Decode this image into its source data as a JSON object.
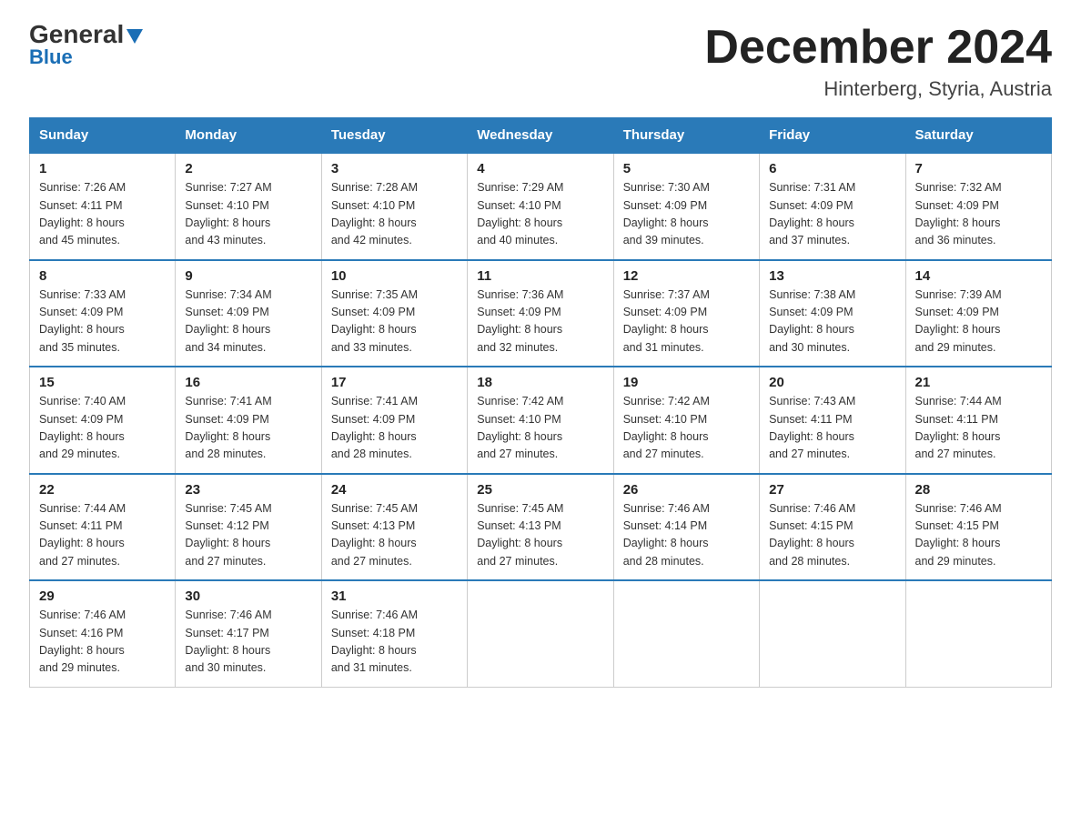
{
  "logo": {
    "part1": "General",
    "part2": "Blue"
  },
  "header": {
    "month": "December 2024",
    "location": "Hinterberg, Styria, Austria"
  },
  "days_of_week": [
    "Sunday",
    "Monday",
    "Tuesday",
    "Wednesday",
    "Thursday",
    "Friday",
    "Saturday"
  ],
  "weeks": [
    [
      {
        "num": "1",
        "sunrise": "7:26 AM",
        "sunset": "4:11 PM",
        "daylight": "8 hours and 45 minutes."
      },
      {
        "num": "2",
        "sunrise": "7:27 AM",
        "sunset": "4:10 PM",
        "daylight": "8 hours and 43 minutes."
      },
      {
        "num": "3",
        "sunrise": "7:28 AM",
        "sunset": "4:10 PM",
        "daylight": "8 hours and 42 minutes."
      },
      {
        "num": "4",
        "sunrise": "7:29 AM",
        "sunset": "4:10 PM",
        "daylight": "8 hours and 40 minutes."
      },
      {
        "num": "5",
        "sunrise": "7:30 AM",
        "sunset": "4:09 PM",
        "daylight": "8 hours and 39 minutes."
      },
      {
        "num": "6",
        "sunrise": "7:31 AM",
        "sunset": "4:09 PM",
        "daylight": "8 hours and 37 minutes."
      },
      {
        "num": "7",
        "sunrise": "7:32 AM",
        "sunset": "4:09 PM",
        "daylight": "8 hours and 36 minutes."
      }
    ],
    [
      {
        "num": "8",
        "sunrise": "7:33 AM",
        "sunset": "4:09 PM",
        "daylight": "8 hours and 35 minutes."
      },
      {
        "num": "9",
        "sunrise": "7:34 AM",
        "sunset": "4:09 PM",
        "daylight": "8 hours and 34 minutes."
      },
      {
        "num": "10",
        "sunrise": "7:35 AM",
        "sunset": "4:09 PM",
        "daylight": "8 hours and 33 minutes."
      },
      {
        "num": "11",
        "sunrise": "7:36 AM",
        "sunset": "4:09 PM",
        "daylight": "8 hours and 32 minutes."
      },
      {
        "num": "12",
        "sunrise": "7:37 AM",
        "sunset": "4:09 PM",
        "daylight": "8 hours and 31 minutes."
      },
      {
        "num": "13",
        "sunrise": "7:38 AM",
        "sunset": "4:09 PM",
        "daylight": "8 hours and 30 minutes."
      },
      {
        "num": "14",
        "sunrise": "7:39 AM",
        "sunset": "4:09 PM",
        "daylight": "8 hours and 29 minutes."
      }
    ],
    [
      {
        "num": "15",
        "sunrise": "7:40 AM",
        "sunset": "4:09 PM",
        "daylight": "8 hours and 29 minutes."
      },
      {
        "num": "16",
        "sunrise": "7:41 AM",
        "sunset": "4:09 PM",
        "daylight": "8 hours and 28 minutes."
      },
      {
        "num": "17",
        "sunrise": "7:41 AM",
        "sunset": "4:09 PM",
        "daylight": "8 hours and 28 minutes."
      },
      {
        "num": "18",
        "sunrise": "7:42 AM",
        "sunset": "4:10 PM",
        "daylight": "8 hours and 27 minutes."
      },
      {
        "num": "19",
        "sunrise": "7:42 AM",
        "sunset": "4:10 PM",
        "daylight": "8 hours and 27 minutes."
      },
      {
        "num": "20",
        "sunrise": "7:43 AM",
        "sunset": "4:11 PM",
        "daylight": "8 hours and 27 minutes."
      },
      {
        "num": "21",
        "sunrise": "7:44 AM",
        "sunset": "4:11 PM",
        "daylight": "8 hours and 27 minutes."
      }
    ],
    [
      {
        "num": "22",
        "sunrise": "7:44 AM",
        "sunset": "4:11 PM",
        "daylight": "8 hours and 27 minutes."
      },
      {
        "num": "23",
        "sunrise": "7:45 AM",
        "sunset": "4:12 PM",
        "daylight": "8 hours and 27 minutes."
      },
      {
        "num": "24",
        "sunrise": "7:45 AM",
        "sunset": "4:13 PM",
        "daylight": "8 hours and 27 minutes."
      },
      {
        "num": "25",
        "sunrise": "7:45 AM",
        "sunset": "4:13 PM",
        "daylight": "8 hours and 27 minutes."
      },
      {
        "num": "26",
        "sunrise": "7:46 AM",
        "sunset": "4:14 PM",
        "daylight": "8 hours and 28 minutes."
      },
      {
        "num": "27",
        "sunrise": "7:46 AM",
        "sunset": "4:15 PM",
        "daylight": "8 hours and 28 minutes."
      },
      {
        "num": "28",
        "sunrise": "7:46 AM",
        "sunset": "4:15 PM",
        "daylight": "8 hours and 29 minutes."
      }
    ],
    [
      {
        "num": "29",
        "sunrise": "7:46 AM",
        "sunset": "4:16 PM",
        "daylight": "8 hours and 29 minutes."
      },
      {
        "num": "30",
        "sunrise": "7:46 AM",
        "sunset": "4:17 PM",
        "daylight": "8 hours and 30 minutes."
      },
      {
        "num": "31",
        "sunrise": "7:46 AM",
        "sunset": "4:18 PM",
        "daylight": "8 hours and 31 minutes."
      },
      null,
      null,
      null,
      null
    ]
  ],
  "labels": {
    "sunrise": "Sunrise:",
    "sunset": "Sunset:",
    "daylight": "Daylight:"
  }
}
